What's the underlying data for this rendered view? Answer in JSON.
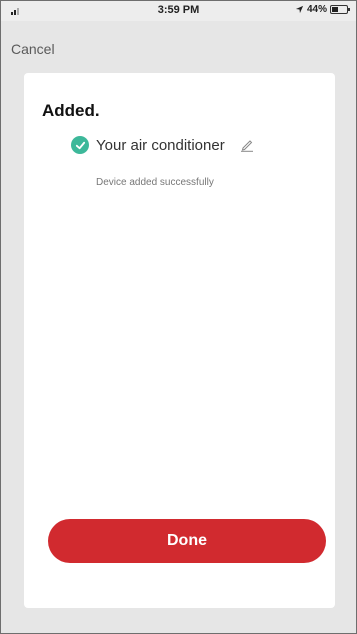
{
  "status_bar": {
    "time": "3:59 PM",
    "battery_percent": "44%",
    "battery_level": 0.44
  },
  "nav": {
    "cancel_label": "Cancel"
  },
  "content": {
    "title": "Added.",
    "device_name": "Your air conditioner",
    "status_message": "Device added successfully"
  },
  "actions": {
    "done_label": "Done"
  },
  "colors": {
    "accent_red": "#d12a2f",
    "success_green": "#3db89a"
  }
}
